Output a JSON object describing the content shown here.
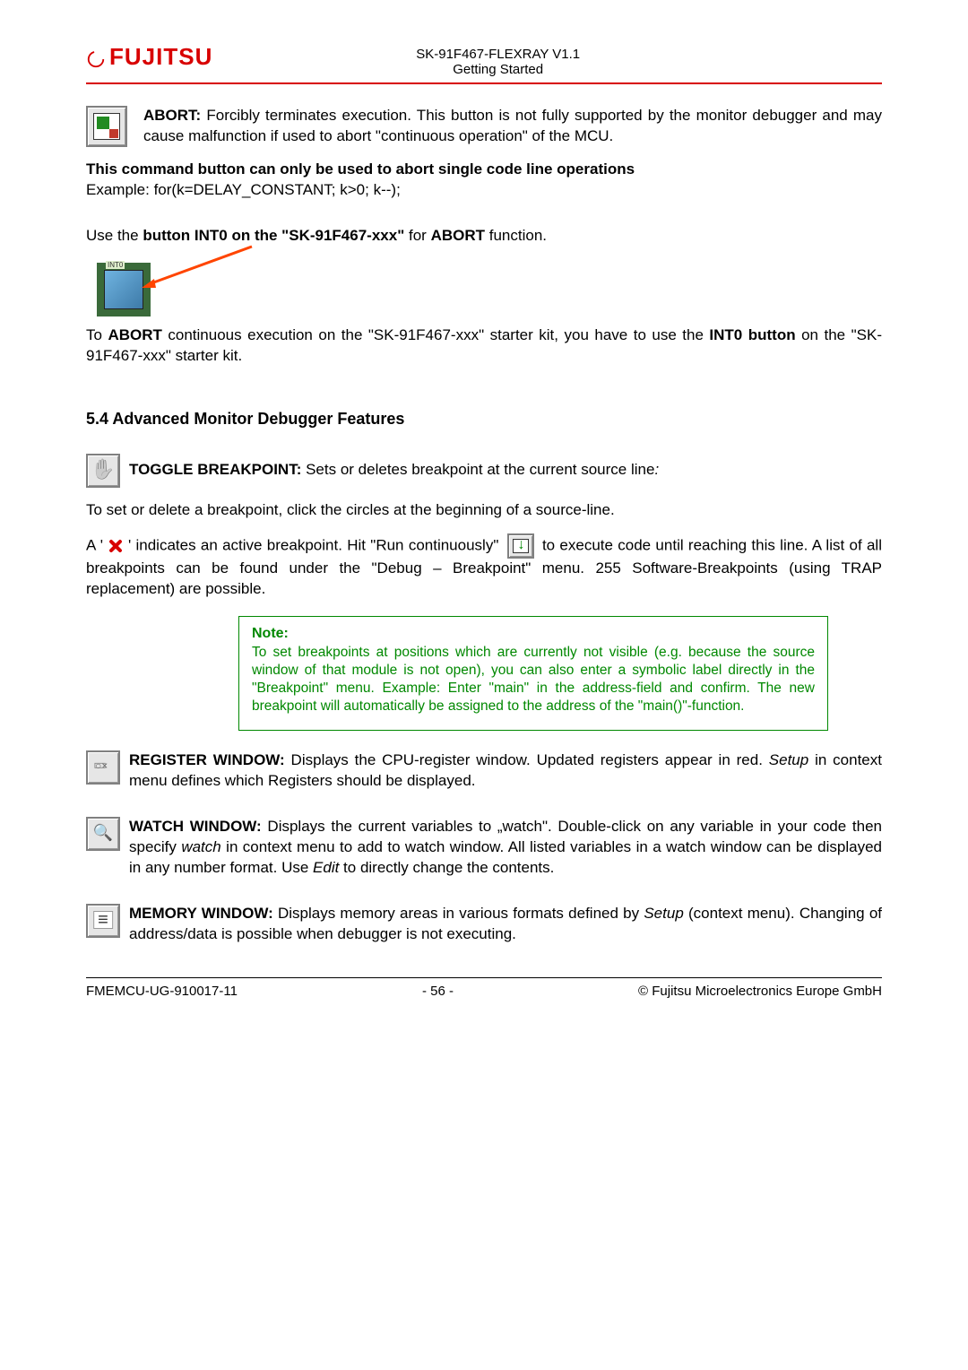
{
  "header": {
    "brand": "FUJITSU",
    "doc_title": "SK-91F467-FLEXRAY V1.1",
    "doc_subtitle": "Getting Started"
  },
  "abort": {
    "title": "ABORT:",
    "text1": " Forcibly terminates execution. This button is not fully supported by the monitor debugger and may cause malfunction if used to abort \"continuous operation\" of the MCU.",
    "bold_line": "This command button can only be used to abort single code line operations",
    "example": "Example: for(k=DELAY_CONSTANT; k>0; k--);",
    "use_pre": "Use the ",
    "use_bold": "button INT0 on the \"SK-91F467-xxx\"",
    "use_post": " for ",
    "use_abort": "ABORT",
    "use_end": " function.",
    "chip_label": "INT0",
    "cont_pre": "To ",
    "cont_b": "ABORT",
    "cont_mid": " continuous execution on the \"SK-91F467-xxx\" starter kit, you have to use the ",
    "cont_b2": "INT0 button",
    "cont_end": " on the \"SK-91F467-xxx\" starter kit."
  },
  "section54": "5.4   Advanced Monitor Debugger Features",
  "toggle": {
    "title": "TOGGLE BREAKPOINT:",
    "text": " Sets or deletes breakpoint at the current source line",
    "colon": ":",
    "line2": "To set or delete a breakpoint, click the circles at the beginning of a source-line.",
    "p2a": "A '",
    "p2b": "' indicates an active breakpoint. Hit \"Run continuously\" ",
    "p2c": " to execute code until reaching this line. A list of all breakpoints can be found under the \"Debug – Breakpoint\" menu. 255 Software-Breakpoints (using TRAP replacement) are possible."
  },
  "note": {
    "title": "Note:",
    "text": "To set breakpoints at positions which are currently not visible (e.g. because the source window of that module is not open), you can also enter a symbolic label directly in the \"Breakpoint\" menu. Example: Enter \"main\" in the address-field and confirm. The new breakpoint will automatically be assigned to the address of the \"main()\"-function."
  },
  "register": {
    "title": "REGISTER WINDOW:",
    "text": " Displays the CPU-register window. Updated registers appear in red. ",
    "ital": "Setup",
    "text2": " in context menu defines which Registers should be displayed."
  },
  "watch": {
    "title": "WATCH WINDOW:",
    "text1": " Displays the current variables to „watch\".  Double-click on any variable in your code then specify ",
    "ital1": "watch",
    "text2": " in context menu to add to watch window. All listed variables in a watch window can be displayed in any number format. Use ",
    "ital2": "Edit",
    "text3": " to directly change the contents."
  },
  "memory": {
    "title": "MEMORY WINDOW:",
    "text1": " Displays memory areas in various formats defined by ",
    "ital": "Setup",
    "text2": " (context menu). Changing of address/data is possible when debugger is not executing."
  },
  "footer": {
    "left": "FMEMCU-UG-910017-11",
    "center": "- 56 -",
    "right": "© Fujitsu Microelectronics Europe GmbH"
  }
}
